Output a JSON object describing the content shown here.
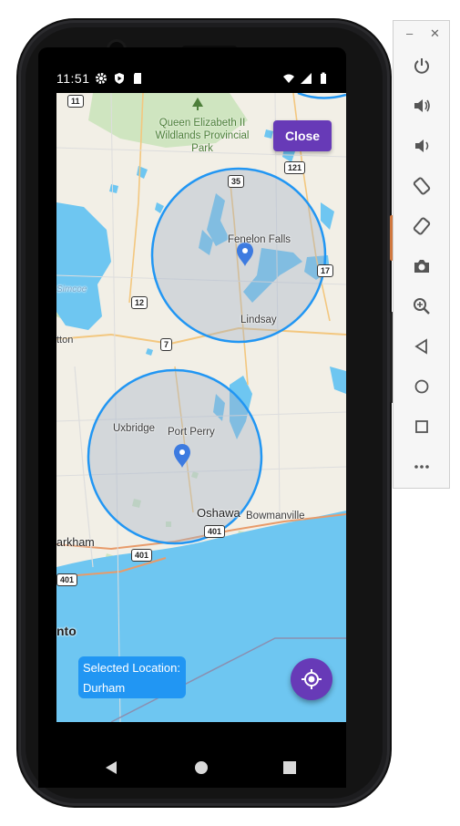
{
  "status_bar": {
    "time": "11:51"
  },
  "map": {
    "places": {
      "park": "Queen Elizabeth II\nWildlands Provincial Park",
      "fenelon_falls": "Fenelon Falls",
      "lindsay": "Lindsay",
      "uxbridge": "Uxbridge",
      "port_perry": "Port Perry",
      "oshawa": "Oshawa",
      "bowmanville": "Bowmanville",
      "markham_partial": "arkham",
      "toronto_partial": "nto",
      "simcoe_partial": "Simcoe",
      "ton_partial": "tton"
    },
    "shields": {
      "s11": "11",
      "s35": "35",
      "s121": "121",
      "s12": "12",
      "s7": "7",
      "s17": "17",
      "s401a": "401",
      "s401b": "401",
      "s401c": "401"
    },
    "colors": {
      "land": "#f2efe6",
      "water": "#6ec6f1",
      "circle_stroke": "#2196f3",
      "circle_fill": "rgba(160,175,200,0.38)",
      "marker": "#3d7be0"
    }
  },
  "close_button": {
    "label": "Close"
  },
  "selected_location": {
    "line1": "Selected Location:",
    "line2": "Durham"
  },
  "fab": {
    "icon": "my-location-icon"
  },
  "nav_bar": {
    "back_icon": "back-triangle-icon",
    "home_icon": "home-circle-icon",
    "recents_icon": "recents-square-icon"
  },
  "emulator_toolbar": {
    "minimize": "–",
    "close": "✕",
    "buttons": [
      "power-icon",
      "volume-up-icon",
      "volume-down-icon",
      "rotate-left-icon",
      "rotate-right-icon",
      "camera-icon",
      "zoom-icon",
      "back-icon",
      "home-icon",
      "overview-icon",
      "more-icon"
    ]
  },
  "accent_color": "#673ab7"
}
